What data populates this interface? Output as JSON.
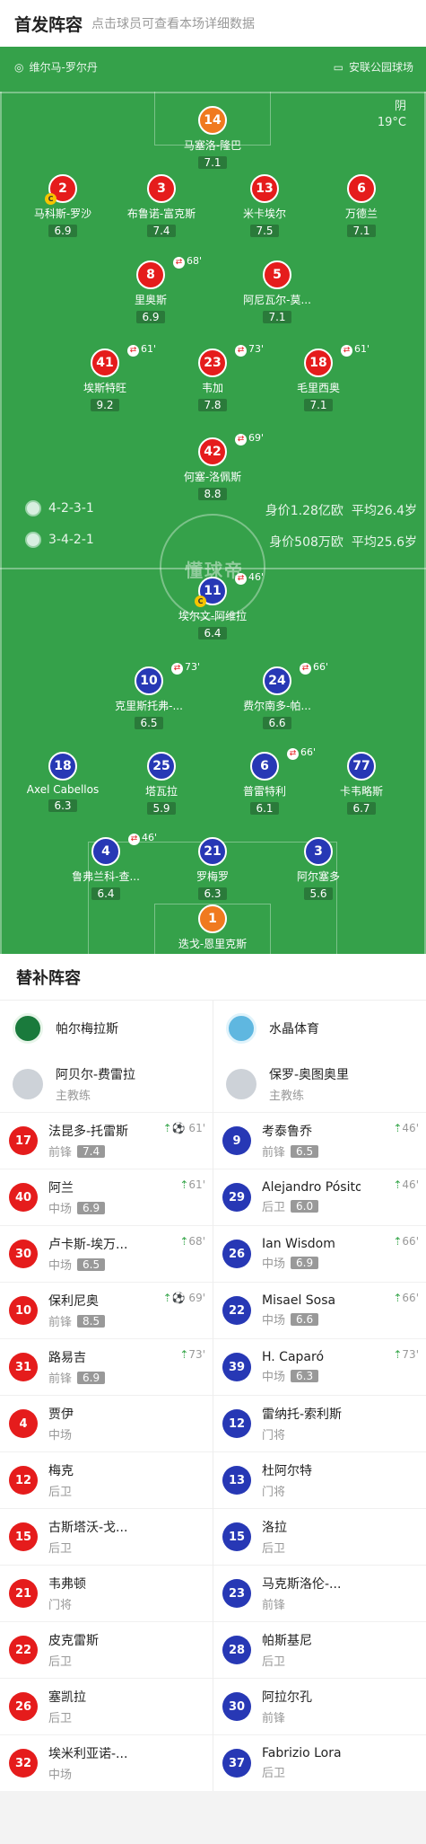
{
  "header": {
    "title": "首发阵容",
    "subtitle": "点击球员可查看本场详细数据"
  },
  "pitch": {
    "coach_home": "维尔马-罗尔丹",
    "stadium": "安联公园球场",
    "weather": "阴",
    "temperature": "19°C",
    "home": {
      "formation": "4-2-3-1",
      "value": "身价1.28亿欧",
      "age": "平均26.4岁"
    },
    "away": {
      "formation": "3-4-2-1",
      "value": "身价508万欧",
      "age": "平均25.6岁"
    },
    "watermark": "懂球帝"
  },
  "home_players": [
    {
      "num": "14",
      "name": "马塞洛-隆巴",
      "rating": "7.1",
      "color": "org"
    },
    {
      "num": "2",
      "name": "马科斯-罗沙",
      "rating": "6.9",
      "color": "red",
      "cap": "C"
    },
    {
      "num": "3",
      "name": "布鲁诺-富克斯",
      "rating": "7.4",
      "color": "red"
    },
    {
      "num": "13",
      "name": "米卡埃尔",
      "rating": "7.5",
      "color": "red"
    },
    {
      "num": "6",
      "name": "万德兰",
      "rating": "7.1",
      "color": "red"
    },
    {
      "num": "8",
      "name": "里奥斯",
      "rating": "6.9",
      "color": "red",
      "sub": "68'"
    },
    {
      "num": "5",
      "name": "阿尼瓦尔-莫...",
      "rating": "7.1",
      "color": "red"
    },
    {
      "num": "41",
      "name": "埃斯特旺",
      "rating": "9.2",
      "color": "red",
      "sub": "61'"
    },
    {
      "num": "23",
      "name": "韦加",
      "rating": "7.8",
      "color": "red",
      "sub": "73'"
    },
    {
      "num": "18",
      "name": "毛里西奥",
      "rating": "7.1",
      "color": "red",
      "sub": "61'"
    },
    {
      "num": "42",
      "name": "何塞-洛佩斯",
      "rating": "8.8",
      "color": "red",
      "sub": "69'"
    }
  ],
  "away_players": [
    {
      "num": "11",
      "name": "埃尔文-阿维拉",
      "rating": "6.4",
      "color": "blu",
      "sub": "46'",
      "cap": "C"
    },
    {
      "num": "10",
      "name": "克里斯托弗-...",
      "rating": "6.5",
      "color": "blu",
      "sub": "73'"
    },
    {
      "num": "24",
      "name": "费尔南多-帕...",
      "rating": "6.6",
      "color": "blu",
      "sub": "66'"
    },
    {
      "num": "18",
      "name": "Axel Cabellos",
      "rating": "6.3",
      "color": "blu"
    },
    {
      "num": "25",
      "name": "塔瓦拉",
      "rating": "5.9",
      "color": "blu"
    },
    {
      "num": "6",
      "name": "普雷特利",
      "rating": "6.1",
      "color": "blu",
      "sub": "66'"
    },
    {
      "num": "77",
      "name": "卡韦略斯",
      "rating": "6.7",
      "color": "blu"
    },
    {
      "num": "4",
      "name": "鲁弗兰科-查...",
      "rating": "6.4",
      "color": "blu",
      "sub": "46'"
    },
    {
      "num": "21",
      "name": "罗梅罗",
      "rating": "6.3",
      "color": "blu"
    },
    {
      "num": "3",
      "name": "阿尔塞多",
      "rating": "5.6",
      "color": "blu"
    },
    {
      "num": "1",
      "name": "迭戈-恩里克斯",
      "rating": "7.0",
      "color": "org"
    }
  ],
  "subs": {
    "title": "替补阵容",
    "home": {
      "team": "帕尔梅拉斯",
      "coach": "阿贝尔-费雷拉",
      "coach_role": "主教练",
      "players": [
        {
          "num": "17",
          "name": "法昆多-托雷斯",
          "pos": "前锋",
          "rating": "7.4",
          "ev": "⚽ 61'"
        },
        {
          "num": "40",
          "name": "阿兰",
          "pos": "中场",
          "rating": "6.9",
          "ev": "61'"
        },
        {
          "num": "30",
          "name": "卢卡斯-埃万...",
          "pos": "中场",
          "rating": "6.5",
          "ev": "68'"
        },
        {
          "num": "10",
          "name": "保利尼奥",
          "pos": "前锋",
          "rating": "8.5",
          "ev": "⚽ 69'"
        },
        {
          "num": "31",
          "name": "路易吉",
          "pos": "前锋",
          "rating": "6.9",
          "ev": "73'"
        },
        {
          "num": "4",
          "name": "贾伊",
          "pos": "中场",
          "rating": "",
          "ev": ""
        },
        {
          "num": "12",
          "name": "梅克",
          "pos": "后卫",
          "rating": "",
          "ev": ""
        },
        {
          "num": "15",
          "name": "古斯塔沃-戈...",
          "pos": "后卫",
          "rating": "",
          "ev": ""
        },
        {
          "num": "21",
          "name": "韦弗顿",
          "pos": "门将",
          "rating": "",
          "ev": ""
        },
        {
          "num": "22",
          "name": "皮克雷斯",
          "pos": "后卫",
          "rating": "",
          "ev": ""
        },
        {
          "num": "26",
          "name": "塞凯拉",
          "pos": "后卫",
          "rating": "",
          "ev": ""
        },
        {
          "num": "32",
          "name": "埃米利亚诺-...",
          "pos": "中场",
          "rating": "",
          "ev": ""
        }
      ]
    },
    "away": {
      "team": "水晶体育",
      "coach": "保罗-奥图奥里",
      "coach_role": "主教练",
      "players": [
        {
          "num": "9",
          "name": "考泰鲁乔",
          "pos": "前锋",
          "rating": "6.5",
          "ev": "46'"
        },
        {
          "num": "29",
          "name": "Alejandro Pósito",
          "pos": "后卫",
          "rating": "6.0",
          "ev": "46'"
        },
        {
          "num": "26",
          "name": "Ian Wisdom",
          "pos": "中场",
          "rating": "6.9",
          "ev": "66'"
        },
        {
          "num": "22",
          "name": "Misael Sosa",
          "pos": "中场",
          "rating": "6.6",
          "ev": "66'"
        },
        {
          "num": "39",
          "name": "H. Caparó",
          "pos": "中场",
          "rating": "6.3",
          "ev": "73'"
        },
        {
          "num": "12",
          "name": "雷纳托-索利斯",
          "pos": "门将",
          "rating": "",
          "ev": ""
        },
        {
          "num": "13",
          "name": "杜阿尔特",
          "pos": "门将",
          "rating": "",
          "ev": ""
        },
        {
          "num": "15",
          "name": "洛拉",
          "pos": "后卫",
          "rating": "",
          "ev": ""
        },
        {
          "num": "23",
          "name": "马克斯洛伦-...",
          "pos": "前锋",
          "rating": "",
          "ev": ""
        },
        {
          "num": "28",
          "name": "帕斯基尼",
          "pos": "后卫",
          "rating": "",
          "ev": ""
        },
        {
          "num": "30",
          "name": "阿拉尔孔",
          "pos": "前锋",
          "rating": "",
          "ev": ""
        },
        {
          "num": "37",
          "name": "Fabrizio Lora",
          "pos": "后卫",
          "rating": "",
          "ev": ""
        }
      ]
    }
  }
}
